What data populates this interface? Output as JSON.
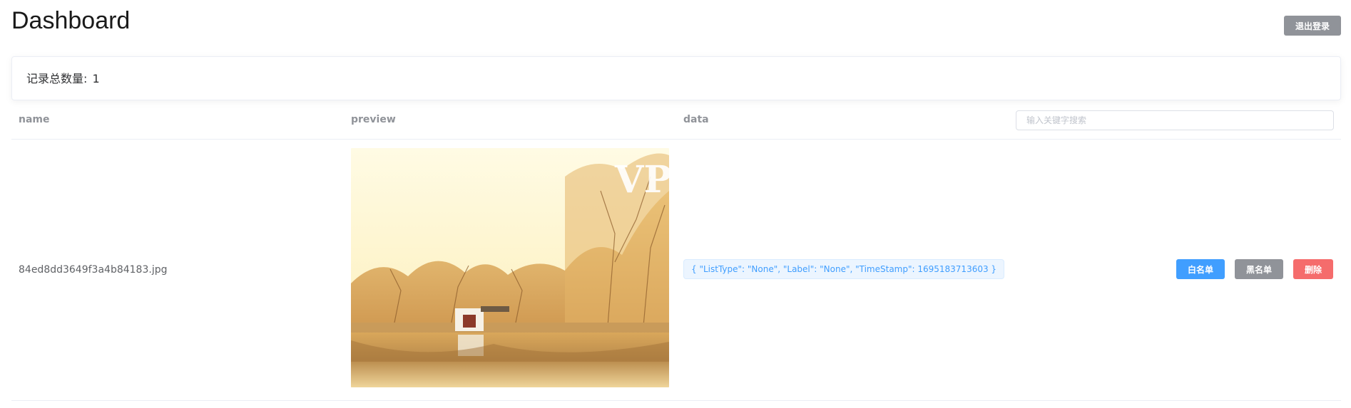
{
  "header": {
    "title": "Dashboard",
    "logout_label": "退出登录"
  },
  "summary": {
    "label": "记录总数量:",
    "count": "1"
  },
  "table": {
    "columns": {
      "name": "name",
      "preview": "preview",
      "data": "data"
    },
    "search": {
      "placeholder": "输入关键字搜索",
      "value": ""
    },
    "rows": [
      {
        "name": "84ed8dd3649f3a4b84183.jpg",
        "preview_text": "VP",
        "data": "{ \"ListType\": \"None\", \"Label\": \"None\", \"TimeStamp\": 1695183713603 }",
        "actions": {
          "whitelist": "白名单",
          "blacklist": "黑名单",
          "delete": "删除"
        }
      }
    ]
  },
  "colors": {
    "primary": "#409eff",
    "info": "#909399",
    "danger": "#f56c6c"
  }
}
